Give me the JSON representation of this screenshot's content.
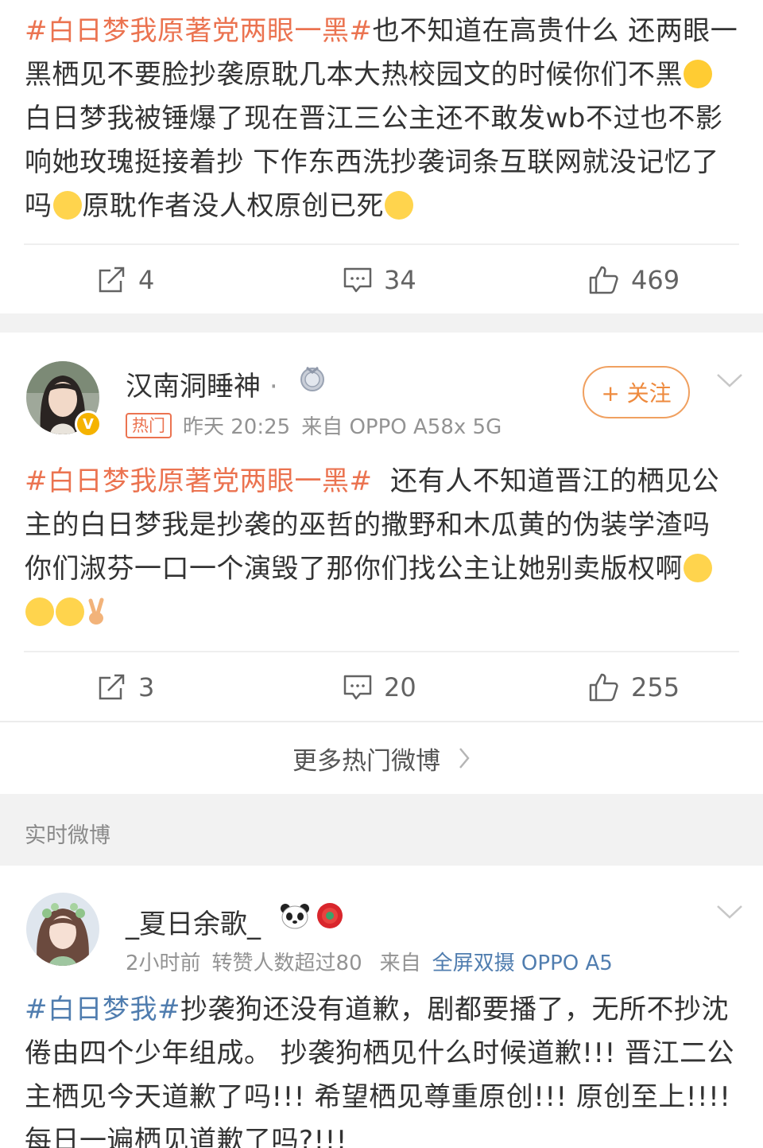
{
  "posts": [
    {
      "topic": "#白日梦我原著党两眼一黑#",
      "text_a": "也不知道在高贵什么 还两眼一黑栖见不要脸抄袭原耽几本大热校园文的时候你们不黑",
      "text_b": "白日梦我被锤爆了现在晋江三公主还不敢发wb不过也不影响她玫瑰挺接着抄 下作东西洗抄袭词条互联网就没记忆了吗",
      "text_c": "原耽作者没人权原创已死",
      "reposts": "4",
      "comments": "34",
      "likes": "469"
    },
    {
      "username": "汉南洞睡神",
      "username_suffix": "·",
      "hot_label": "热门",
      "time": "昨天 20:25",
      "source": "来自 OPPO A58x 5G",
      "follow_label": "+ 关注",
      "topic": "#白日梦我原著党两眼一黑#",
      "text": "  还有人不知道晋江的栖见公主的白日梦我是抄袭的巫哲的撒野和木瓜黄的伪装学渣吗 你们淑芬一口一个演毁了那你们找公主让她别卖版权啊",
      "reposts": "3",
      "comments": "20",
      "likes": "255"
    },
    {
      "username": "_夏日余歌_",
      "time": "2小时前",
      "reposts_note": "转赞人数超过80",
      "source_prefix": "来自",
      "source": "全屏双摄 OPPO A5",
      "topic": "#白日梦我#",
      "text": "抄袭狗还没有道歉，剧都要播了，无所不抄沈倦由四个少年组成。 抄袭狗栖见什么时候道歉!!! 晋江二公主栖见今天道歉了吗!!! 希望栖见尊重原创!!! 原创至上!!!! 每日一遍栖见道歉了吗?!!!"
    }
  ],
  "more_hot_label": "更多热门微博",
  "realtime_section_label": "实时微博",
  "icons": {
    "repost": "repost-icon",
    "comment": "comment-icon",
    "like": "like-icon",
    "more": "chevron-down-icon",
    "arrow": "chevron-right-icon",
    "medal": "medal-icon",
    "panda": "panda-icon",
    "flower": "flower-icon"
  },
  "colors": {
    "topic": "#eb7350",
    "link_blue": "#507daf",
    "follow": "#ee8a3e",
    "muted": "#939393"
  }
}
